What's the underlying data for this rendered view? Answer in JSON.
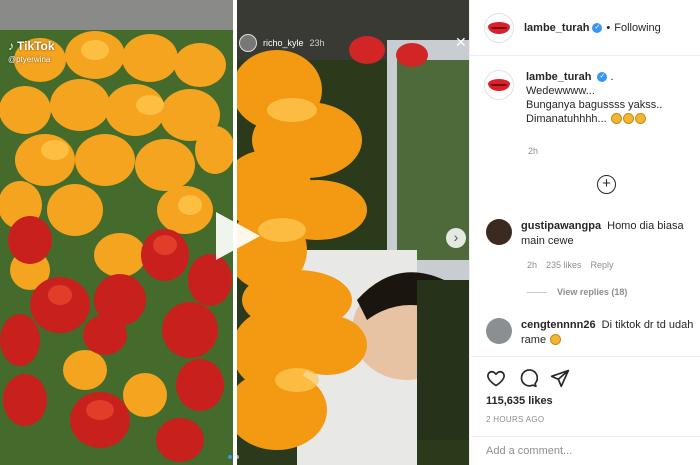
{
  "media": {
    "tiktok_brand": "TikTok",
    "tiktok_user": "@ptyerwina",
    "story_user": "richo_kyle",
    "story_time": "23h"
  },
  "header": {
    "username": "lambe_turah",
    "separator": "•",
    "follow_label": "Following"
  },
  "caption": {
    "username": "lambe_turah",
    "suffix": ".",
    "lines": [
      "Wedewwww...",
      "Bunganya bagussss yakss..",
      "Dimanatuhhhh..."
    ],
    "time": "2h"
  },
  "comments": [
    {
      "username": "gustipawangpa",
      "text": "Homo dia biasa main cewe",
      "time": "2h",
      "likes": "235 likes",
      "reply": "Reply",
      "view_replies": "View replies (18)"
    },
    {
      "username": "cengtennnn26",
      "text": "Di tiktok dr td udah rame"
    }
  ],
  "actions": {
    "likes": "115,635 likes",
    "ago": "2 HOURS AGO",
    "add_comment_placeholder": "Add a comment..."
  },
  "colors": {
    "accent": "#3897f0",
    "lips": "#d9202b"
  }
}
